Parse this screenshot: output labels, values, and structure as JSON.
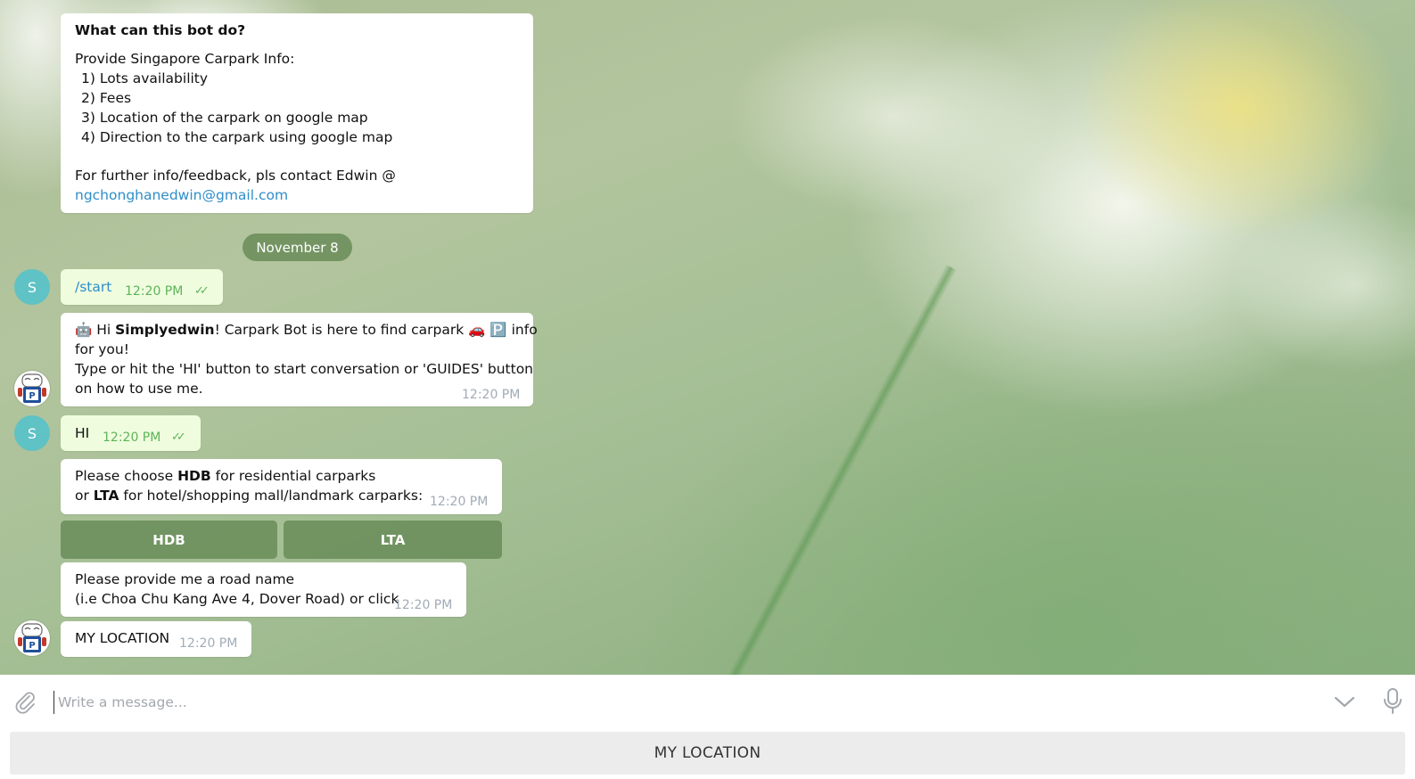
{
  "colors": {
    "incoming_bubble": "#ffffff",
    "outgoing_bubble": "#effdde",
    "link": "#2f8ec9",
    "accent_green": "#5eb35a",
    "avatar_s": "#5fc2c5",
    "keyboard_button": "#688c58"
  },
  "intro": {
    "title": "What can this bot do?",
    "line1": "Provide Singapore Carpark Info:",
    "item1": "1) Lots availability",
    "item2": "2) Fees",
    "item3": "3) Location of the carpark on google map",
    "item4": "4) Direction to the carpark using google map",
    "contact": "For further info/feedback, pls contact Edwin @",
    "email": "ngchonghanedwin@gmail.com"
  },
  "date_separator": "November 8",
  "messages": {
    "start_cmd": {
      "text": "/start",
      "time": "12:20 PM",
      "avatar": "S"
    },
    "welcome": {
      "hi": " Hi ",
      "name": "Simplyedwin",
      "rest": "! Carpark Bot is here to find carpark ",
      "after_emoji": " info",
      "line2": "for you!",
      "line3": "Type or hit the 'HI' button to start conversation or 'GUIDES' button",
      "line4": "on how to use me.",
      "time": "12:20 PM",
      "emoji_robot": "🤖",
      "emoji_car": "🚗",
      "emoji_parking": "🅿️"
    },
    "hi_msg": {
      "text": "HI",
      "time": "12:20 PM",
      "avatar": "S"
    },
    "choose": {
      "pre": "Please choose ",
      "hdb": "HDB",
      "mid": " for residential carparks",
      "pre2": " or ",
      "lta": "LTA",
      "post2": " for hotel/shopping mall/landmark carparks:",
      "time": "12:20 PM"
    },
    "inline_buttons": {
      "hdb": "HDB",
      "lta": "LTA"
    },
    "road": {
      "line1": "Please provide me a road name",
      "line2": " (i.e Choa Chu Kang Ave 4, Dover Road) or click",
      "time": "12:20 PM"
    },
    "my_location": {
      "text": "MY LOCATION",
      "time": "12:20 PM"
    }
  },
  "composer": {
    "placeholder": "Write a message...",
    "attach_icon": "paperclip-icon",
    "scroll_icon": "chevron-down-icon",
    "mic_icon": "microphone-icon"
  },
  "reply_keyboard": {
    "button": "MY LOCATION"
  }
}
